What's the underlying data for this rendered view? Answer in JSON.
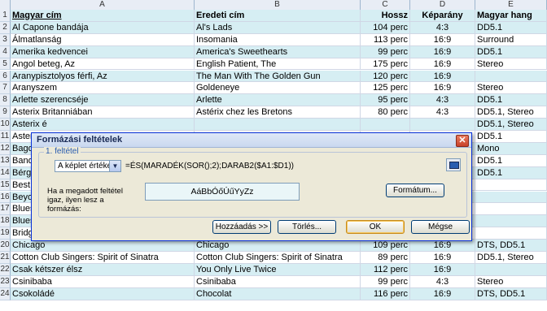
{
  "columns": [
    "A",
    "B",
    "C",
    "D",
    "E"
  ],
  "header_row": {
    "num": "1",
    "a": "Magyar cím",
    "b": "Eredeti cím",
    "c": "Hossz",
    "d": "Képarány",
    "e": "Magyar hang"
  },
  "rows": [
    {
      "num": "2",
      "a": "Al Capone bandája",
      "b": "Al's Lads",
      "c": "104 perc",
      "d": "4:3",
      "e": "DD5.1"
    },
    {
      "num": "3",
      "a": "Álmatlanság",
      "b": "Insomania",
      "c": "113 perc",
      "d": "16:9",
      "e": "Surround"
    },
    {
      "num": "4",
      "a": "Amerika kedvencei",
      "b": "America's Sweethearts",
      "c": "99 perc",
      "d": "16:9",
      "e": "DD5.1"
    },
    {
      "num": "5",
      "a": "Angol beteg, Az",
      "b": "English Patient, The",
      "c": "175 perc",
      "d": "16:9",
      "e": "Stereo"
    },
    {
      "num": "6",
      "a": "Aranypisztolyos férfi, Az",
      "b": "The Man With The Golden Gun",
      "c": "120 perc",
      "d": "16:9",
      "e": ""
    },
    {
      "num": "7",
      "a": "Aranyszem",
      "b": "Goldeneye",
      "c": "125 perc",
      "d": "16:9",
      "e": "Stereo"
    },
    {
      "num": "8",
      "a": "Arlette szerencséje",
      "b": "Arlette",
      "c": "95 perc",
      "d": "4:3",
      "e": "DD5.1"
    },
    {
      "num": "9",
      "a": "Asterix Britanniában",
      "b": "Astérix chez les Bretons",
      "c": "80 perc",
      "d": "4:3",
      "e": "DD5.1, Stereo"
    },
    {
      "num": "10",
      "a": "Asterix é",
      "b": "",
      "c": "",
      "d": "",
      "e": "DD5.1, Stereo"
    },
    {
      "num": "11",
      "a": "Asterix é",
      "b": "",
      "c": "",
      "d": "",
      "e": "DD5.1"
    },
    {
      "num": "12",
      "a": "Bagdadi",
      "b": "",
      "c": "",
      "d": "",
      "e": "Mono"
    },
    {
      "num": "13",
      "a": "Banditák",
      "b": "",
      "c": "",
      "d": "",
      "e": "DD5.1"
    },
    {
      "num": "14",
      "a": "Bérgyilkó",
      "b": "",
      "c": "",
      "d": "",
      "e": "DD5.1"
    },
    {
      "num": "15",
      "a": "Best of N",
      "b": "",
      "c": "",
      "d": "",
      "e": ""
    },
    {
      "num": "16",
      "a": "Beyond T",
      "b": "",
      "c": "",
      "d": "",
      "e": ""
    },
    {
      "num": "17",
      "a": "Blues Br",
      "b": "",
      "c": "",
      "d": "",
      "e": ""
    },
    {
      "num": "18",
      "a": "Blues Br",
      "b": "",
      "c": "",
      "d": "",
      "e": ""
    },
    {
      "num": "19",
      "a": "Bridget Jones naplója",
      "b": "Bridget Jones's Diary",
      "c": "97 perc",
      "d": "16:9",
      "e": ""
    },
    {
      "num": "20",
      "a": "Chicago",
      "b": "Chicago",
      "c": "109 perc",
      "d": "16:9",
      "e": "DTS, DD5.1"
    },
    {
      "num": "21",
      "a": "Cotton Club Singers: Spirit of Sinatra",
      "b": "Cotton Club Singers: Spirit of Sinatra",
      "c": "89 perc",
      "d": "16:9",
      "e": "DD5.1, Stereo"
    },
    {
      "num": "22",
      "a": "Csak kétszer élsz",
      "b": "You Only Live Twice",
      "c": "112 perc",
      "d": "16:9",
      "e": ""
    },
    {
      "num": "23",
      "a": "Csinibaba",
      "b": "Csinibaba",
      "c": "99 perc",
      "d": "4:3",
      "e": "Stereo"
    },
    {
      "num": "24",
      "a": "Csokoládé",
      "b": "Chocolat",
      "c": "116 perc",
      "d": "16:9",
      "e": "DTS, DD5.1"
    }
  ],
  "dialog": {
    "title": "Formázási feltételek",
    "close_label": "✕",
    "group_label": "1. feltétel",
    "select_value": "A képlet értéke",
    "formula": "=ÉS(MARADÉK(SOR();2);DARAB2($A1:$D1))",
    "condition_text": "Ha a megadott feltétel igaz, ilyen lesz a formázás:",
    "preview_text": "AáBbÓőÚűYyZz",
    "format_button": "Formátum...",
    "add_button": "Hozzáadás >>",
    "delete_button": "Törlés...",
    "ok_button": "OK",
    "cancel_button": "Mégse"
  }
}
